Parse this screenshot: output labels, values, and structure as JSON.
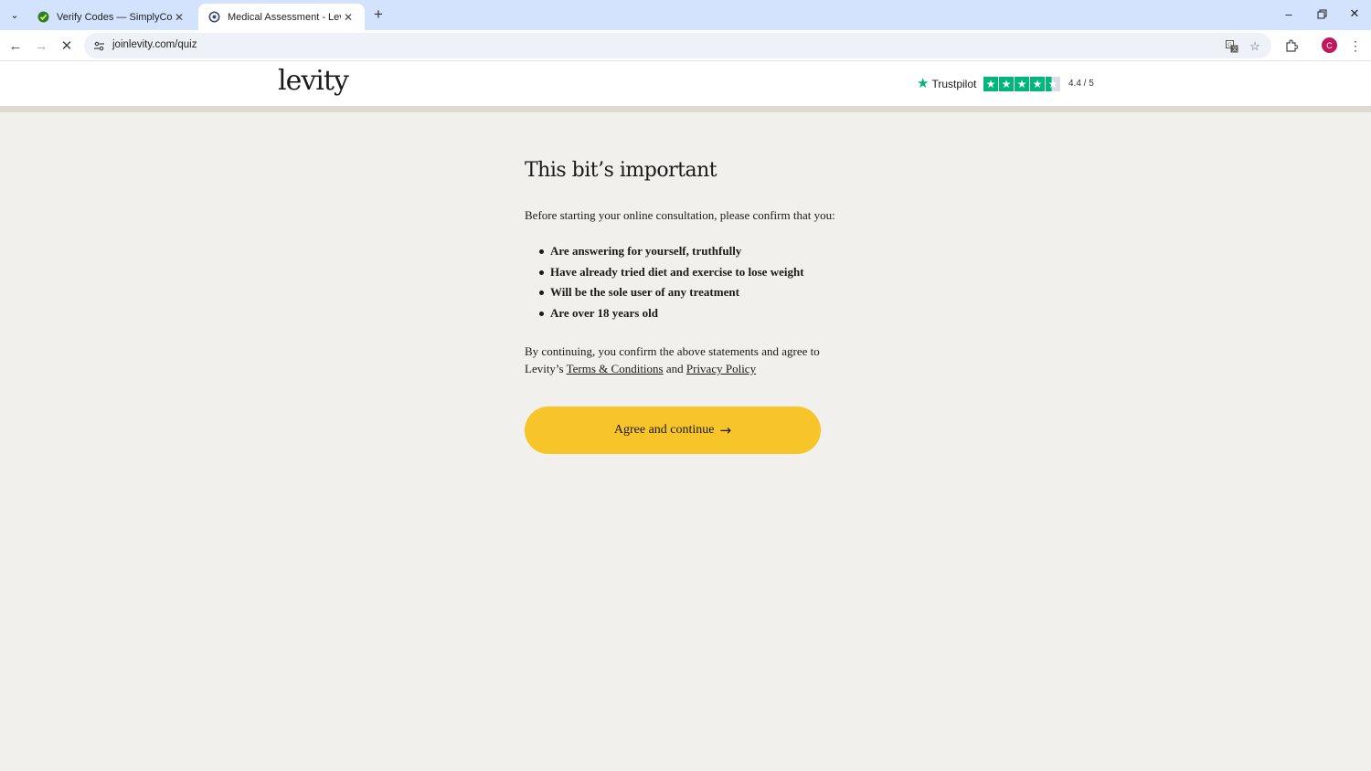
{
  "browser": {
    "tabs": [
      {
        "title": "Verify Codes — SimplyCodes",
        "active": false
      },
      {
        "title": "Medical Assessment - Levity",
        "active": true
      }
    ],
    "url": "joinlevity.com/quiz",
    "profile_initial": "C"
  },
  "header": {
    "logo": "levity",
    "trustpilot": {
      "brand": "Trustpilot",
      "rating": 4.4,
      "score_text": "4.4 / 5",
      "star_color": "#00b67a"
    }
  },
  "main": {
    "heading": "This bit’s important",
    "intro": "Before starting your online consultation, please confirm that you:",
    "bullets": [
      "Are answering for yourself, truthfully",
      "Have already tried diet and exercise to lose weight",
      "Will be the sole user of any treatment",
      "Are over 18 years old"
    ],
    "consent": {
      "prefix": "By continuing, you confirm the above statements and agree to Levity’s",
      "terms_link": "Terms & Conditions",
      "joiner": "and",
      "privacy_link": "Privacy Policy"
    },
    "cta_label": "Agree and continue",
    "cta_color": "#f7c52a"
  },
  "colors": {
    "page_bg": "#f1f0ec",
    "tabbar_bg": "#d3e3fd",
    "divider": "#dcdad1"
  }
}
